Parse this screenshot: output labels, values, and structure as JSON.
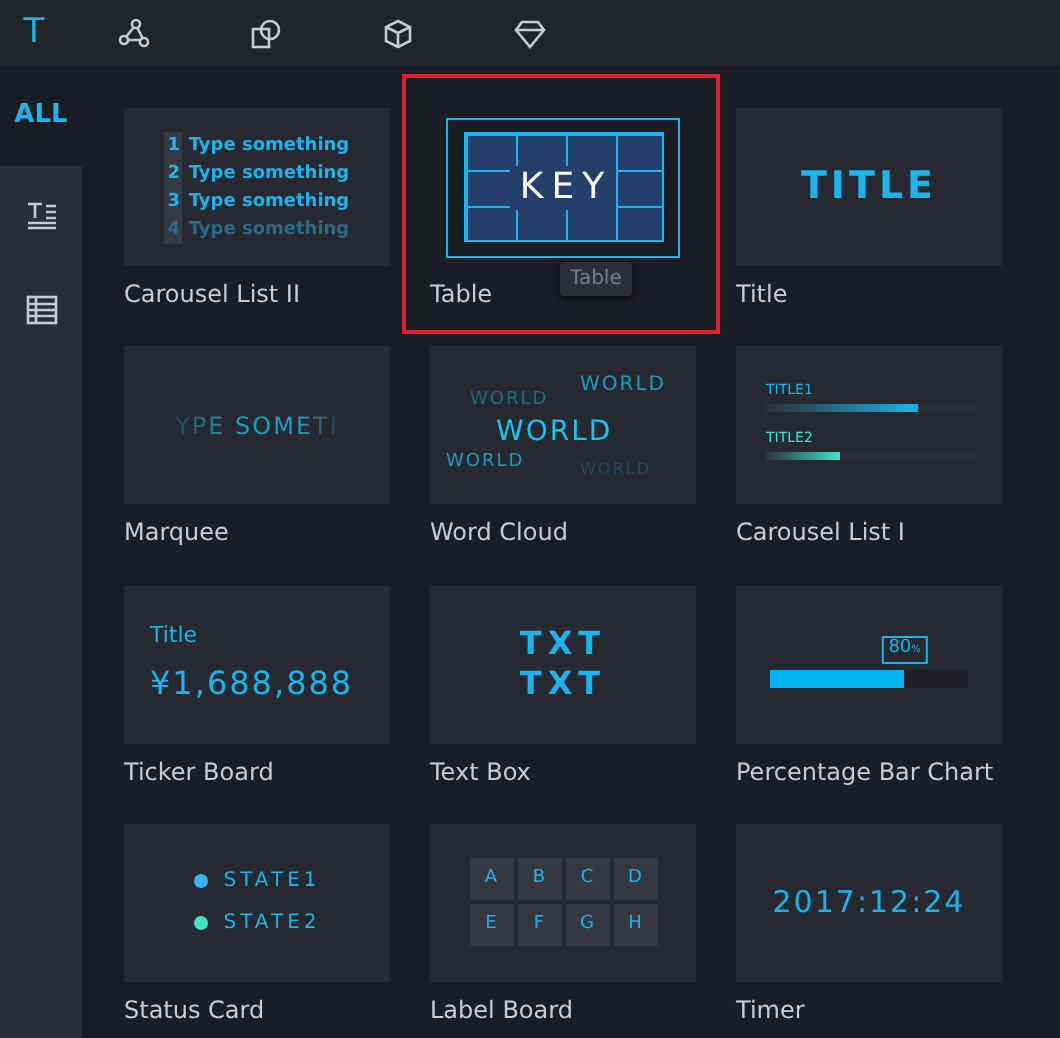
{
  "top_tabs": [
    {
      "kind": "text",
      "label": "T",
      "selected": true
    },
    {
      "kind": "graph",
      "selected": false
    },
    {
      "kind": "shapes",
      "selected": false
    },
    {
      "kind": "cube",
      "selected": false
    },
    {
      "kind": "diamond",
      "selected": false
    }
  ],
  "sidebar": [
    {
      "kind": "text",
      "label": "ALL",
      "selected": true
    },
    {
      "kind": "text-list",
      "selected": false
    },
    {
      "kind": "table",
      "selected": false
    }
  ],
  "components": [
    {
      "kind": "carousel-list",
      "label": "Carousel List II",
      "selected": false,
      "items": [
        {
          "number": "1",
          "text": "Type something",
          "faded": false
        },
        {
          "number": "2",
          "text": "Type something",
          "faded": false
        },
        {
          "number": "3",
          "text": "Type something",
          "faded": false
        },
        {
          "number": "4",
          "text": "Type something",
          "faded": true
        }
      ]
    },
    {
      "kind": "table",
      "label": "Table",
      "selected": true,
      "text": "KEY",
      "tooltip": "Table"
    },
    {
      "kind": "title",
      "label": "Title",
      "selected": false,
      "text": "TITLE"
    },
    {
      "kind": "marquee",
      "label": "Marquee",
      "selected": false,
      "text": "YPE SOMETI"
    },
    {
      "kind": "word-cloud",
      "label": "Word Cloud",
      "selected": false,
      "words": [
        "WORLD",
        "WORLD",
        "WORLD",
        "WORLD",
        "WORLD"
      ]
    },
    {
      "kind": "bar-list",
      "label": "Carousel List I",
      "selected": false,
      "bars": [
        {
          "label": "TITLE1",
          "level": 0.72,
          "color": "#1ab4ee"
        },
        {
          "label": "TITLE2",
          "level": 0.35,
          "color": "#3fe3d2"
        }
      ]
    },
    {
      "kind": "ticker",
      "label": "Ticker Board",
      "selected": false,
      "title": "Title",
      "value": "¥1,688,888"
    },
    {
      "kind": "text-box",
      "label": "Text Box",
      "selected": false,
      "lines": [
        "TXT",
        "TXT"
      ]
    },
    {
      "kind": "percent-bar",
      "label": "Percentage Bar Chart",
      "selected": false,
      "value": "80",
      "unit": "%",
      "level": 0.68
    },
    {
      "kind": "status",
      "label": "Status Card",
      "selected": false,
      "states": [
        {
          "label": "STATE1",
          "color": "#33b6f2"
        },
        {
          "label": "STATE2",
          "color": "#3fe3c6"
        }
      ]
    },
    {
      "kind": "label-board",
      "label": "Label Board",
      "selected": false,
      "labels": [
        "A",
        "B",
        "C",
        "D",
        "E",
        "F",
        "G",
        "H"
      ]
    },
    {
      "kind": "timer",
      "label": "Timer",
      "selected": false,
      "text": "2017:12:24"
    }
  ]
}
